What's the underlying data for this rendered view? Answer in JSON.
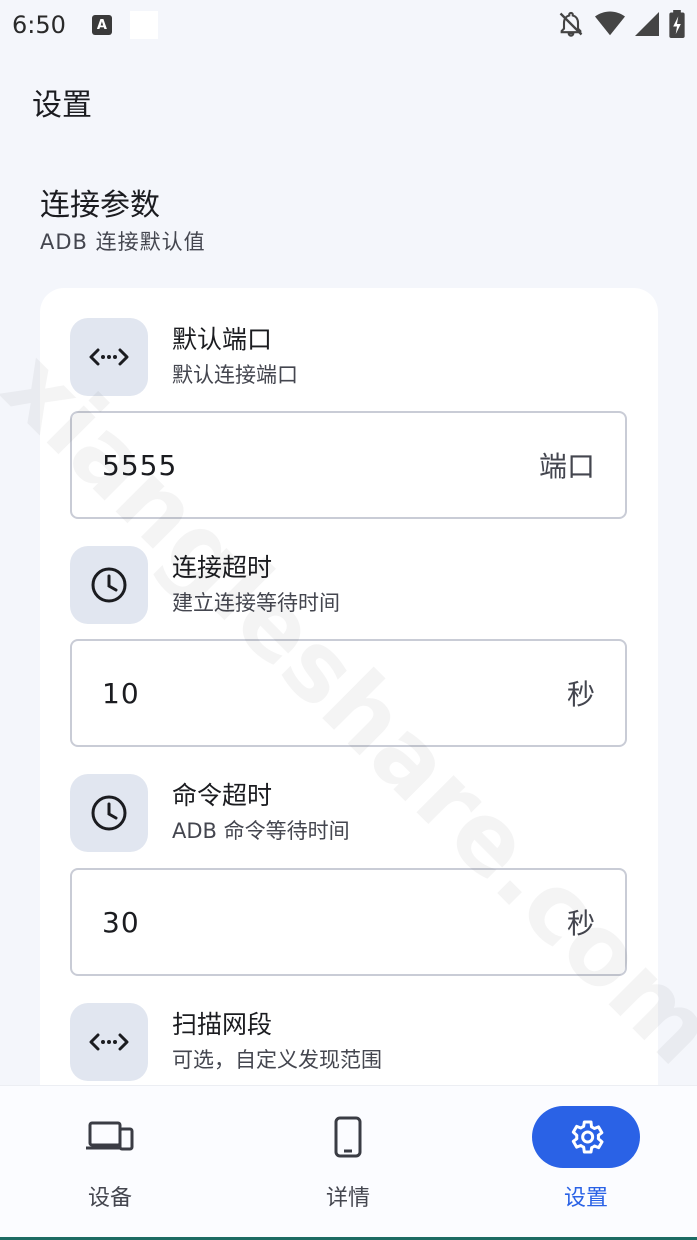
{
  "status_bar": {
    "time": "6:50",
    "notif_letter": "A"
  },
  "top_bar": {
    "title": "设置"
  },
  "section": {
    "title": "连接参数",
    "subtitle": "ADB 连接默认值"
  },
  "settings": [
    {
      "icon": "code-icon",
      "title": "默认端口",
      "subtitle": "默认连接端口",
      "value": "5555",
      "suffix": "端口"
    },
    {
      "icon": "clock-icon",
      "title": "连接超时",
      "subtitle": "建立连接等待时间",
      "value": "10",
      "suffix": "秒"
    },
    {
      "icon": "clock-icon",
      "title": "命令超时",
      "subtitle": "ADB 命令等待时间",
      "value": "30",
      "suffix": "秒"
    },
    {
      "icon": "code-icon",
      "title": "扫描网段",
      "subtitle": "可选，自定义发现范围"
    }
  ],
  "watermark": "xiangleshare.com",
  "nav": {
    "items": [
      {
        "label": "设备",
        "icon": "devices-icon"
      },
      {
        "label": "详情",
        "icon": "phone-icon"
      },
      {
        "label": "设置",
        "icon": "gear-icon",
        "active": true
      }
    ]
  },
  "colors": {
    "accent": "#2a62e6",
    "icon_bg": "#e1e6f0",
    "background": "#f4f6fb"
  }
}
